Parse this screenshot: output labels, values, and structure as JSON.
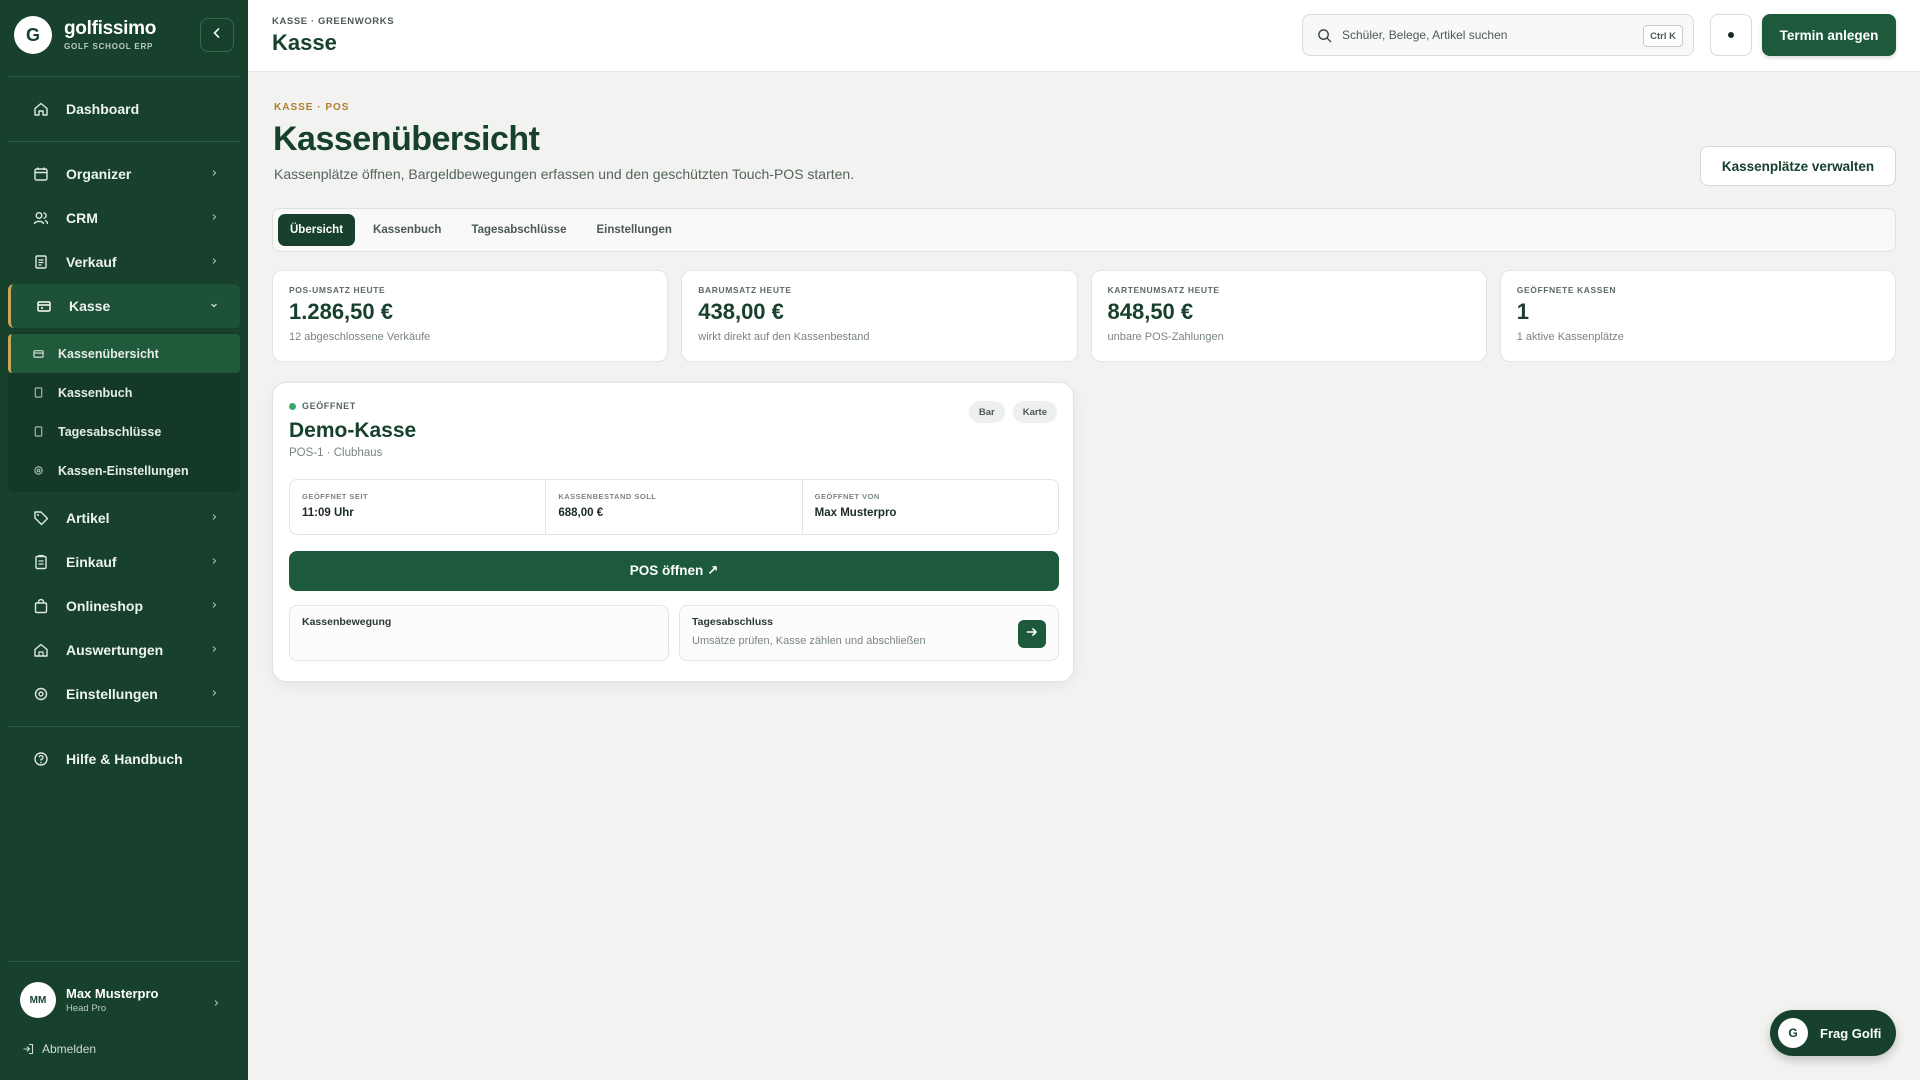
{
  "brand": {
    "logo_letter": "G",
    "name": "golfissimo",
    "subtitle": "GOLF SCHOOL ERP"
  },
  "sidebar": {
    "items": [
      {
        "label": "Dashboard",
        "icon": "home-icon"
      },
      {
        "label": "Organizer",
        "icon": "calendar-icon"
      },
      {
        "label": "CRM",
        "icon": "users-icon"
      },
      {
        "label": "Verkauf",
        "icon": "receipt-icon"
      },
      {
        "label": "Kasse",
        "icon": "register-icon"
      },
      {
        "label": "Artikel",
        "icon": "tag-icon"
      },
      {
        "label": "Einkauf",
        "icon": "clipboard-icon"
      },
      {
        "label": "Onlineshop",
        "icon": "bag-icon"
      },
      {
        "label": "Auswertungen",
        "icon": "chart-icon"
      },
      {
        "label": "Einstellungen",
        "icon": "gear-icon"
      },
      {
        "label": "Hilfe & Handbuch",
        "icon": "help-icon"
      }
    ],
    "kasse_sub": [
      {
        "label": "Kassenübersicht"
      },
      {
        "label": "Kassenbuch"
      },
      {
        "label": "Tagesabschlüsse"
      },
      {
        "label": "Kassen-Einstellungen"
      }
    ],
    "user": {
      "initials": "MM",
      "name": "Max Musterpro",
      "role": "Head Pro"
    },
    "logout_label": "Abmelden"
  },
  "header": {
    "breadcrumb": "KASSE · GREENWORKS",
    "title": "Kasse",
    "search_placeholder": "Schüler, Belege, Artikel suchen",
    "search_shortcut": "Ctrl K",
    "primary_button": "Termin anlegen"
  },
  "page": {
    "eyebrow": "KASSE · POS",
    "title": "Kassenübersicht",
    "description": "Kassenplätze öffnen, Bargeldbewegungen erfassen und den geschützten Touch-POS starten.",
    "manage_button": "Kassenplätze verwalten",
    "tabs": [
      "Übersicht",
      "Kassenbuch",
      "Tagesabschlüsse",
      "Einstellungen"
    ],
    "active_tab": "Übersicht"
  },
  "stats": [
    {
      "label": "POS-UMSATZ HEUTE",
      "value": "1.286,50 €",
      "sub": "12 abgeschlossene Verkäufe"
    },
    {
      "label": "BARUMSATZ HEUTE",
      "value": "438,00 €",
      "sub": "wirkt direkt auf den Kassenbestand"
    },
    {
      "label": "KARTENUMSATZ HEUTE",
      "value": "848,50 €",
      "sub": "unbare POS-Zahlungen"
    },
    {
      "label": "GEÖFFNETE KASSEN",
      "value": "1",
      "sub": "1 aktive Kassenplätze"
    }
  ],
  "register": {
    "status": "GEÖFFNET",
    "status_color": "#3aa86a",
    "chips": [
      "Bar",
      "Karte"
    ],
    "name": "Demo-Kasse",
    "location": "POS-1 · Clubhaus",
    "info": [
      {
        "label": "GEÖFFNET SEIT",
        "value": "11:09 Uhr"
      },
      {
        "label": "KASSENBESTAND SOLL",
        "value": "688,00 €"
      },
      {
        "label": "GEÖFFNET VON",
        "value": "Max Musterpro"
      }
    ],
    "open_pos_button": "POS öffnen ↗",
    "actions": [
      {
        "title": "Kassenbewegung",
        "sub": ""
      },
      {
        "title": "Tagesabschluss",
        "sub": "Umsätze prüfen, Kasse zählen und abschließen"
      }
    ]
  },
  "help_fab": {
    "letter": "G",
    "label": "Frag Golfi"
  },
  "colors": {
    "brand_green": "#17412c",
    "accent_gold": "#c9a45c",
    "button_green": "#1c5a3b"
  }
}
